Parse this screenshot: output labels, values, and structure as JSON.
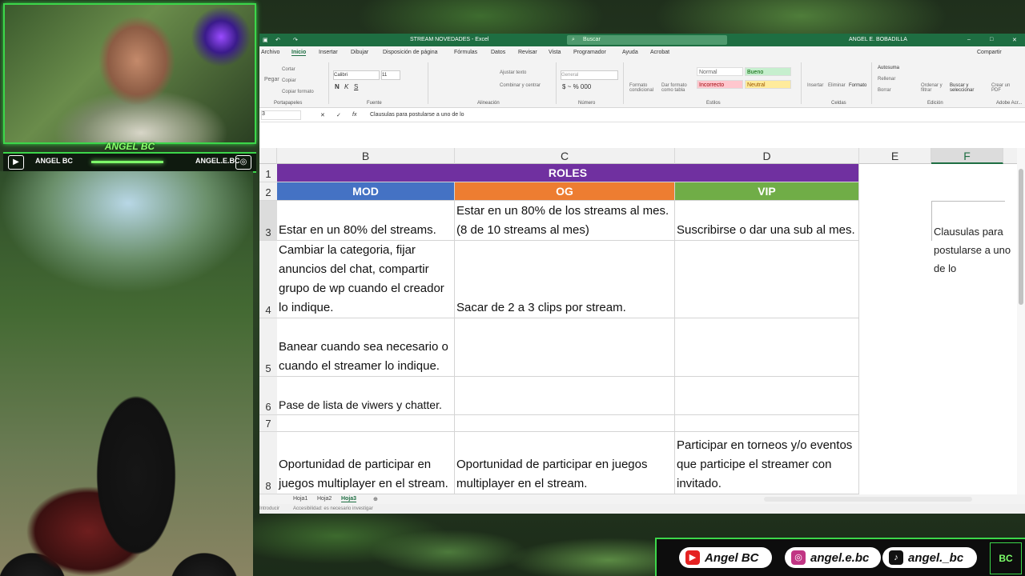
{
  "streamer": {
    "cam_name": "ANGEL BC",
    "cam_left_label": "ANGEL BC",
    "cam_right_label": "ANGEL.E.BC"
  },
  "excel": {
    "title": "STREAM NOVEDADES - Excel",
    "search_placeholder": "Buscar",
    "user": "ANGEL E. BOBADILLA",
    "share_label": "Compartir",
    "menu": [
      "Archivo",
      "Inicio",
      "Insertar",
      "Dibujar",
      "Disposición de página",
      "Fórmulas",
      "Datos",
      "Revisar",
      "Vista",
      "Programador",
      "Ayuda",
      "Acrobat"
    ],
    "ribbon": {
      "font_name": "Calibri",
      "font_size": "11",
      "pegar": "Pegar",
      "cortar": "Cortar",
      "copiar": "Copiar",
      "copiar_formato": "Copiar formato",
      "ajustar_texto": "Ajustar texto",
      "combinar": "Combinar y centrar",
      "number_format": "General",
      "formato_condicional": "Formato condicional",
      "dar_formato_tabla": "Dar formato como tabla",
      "styles": [
        "Normal",
        "Bueno",
        "Incorrecto",
        "Neutral"
      ],
      "insertar": "Insertar",
      "eliminar": "Eliminar",
      "formato": "Formato",
      "autosuma": "Autosuma",
      "rellenar": "Rellenar",
      "borrar": "Borrar",
      "ordenar": "Ordenar y filtrar",
      "buscar": "Buscar y seleccionar",
      "crear_pdf": "Crear un PDF",
      "groups": [
        "Portapapeles",
        "Fuente",
        "Alineación",
        "Número",
        "Estilos",
        "Celdas",
        "Edición",
        "Adobe Acr..."
      ]
    },
    "formula_bar": {
      "name_box": "3",
      "content": "Clausulas para postularse a uno de lo"
    },
    "columns": [
      "B",
      "C",
      "D",
      "E",
      "F"
    ],
    "rows": [
      "1",
      "2",
      "3",
      "4",
      "5",
      "6",
      "7",
      "8"
    ],
    "cells": {
      "roles": "ROLES",
      "mod": "MOD",
      "og": "OG",
      "vip": "VIP",
      "r3b": "Estar en un 80% del streams.",
      "r3c": "Estar en un 80% de los streams al mes. (8 de 10 streams al mes)",
      "r3d": "Suscribirse o dar una sub al mes.",
      "r4b": "Cambiar la categoria, fijar anuncios del chat, compartir grupo de wp cuando el creador lo indique.",
      "r4c": "Sacar de 2 a 3 clips por stream.",
      "r5b": "Banear cuando sea necesario o cuando el streamer lo indique.",
      "r6b": "Pase de lista de viwers y chatter.",
      "r8b": "Oportunidad de participar en juegos multiplayer en el stream.",
      "r8c": "Oportunidad de participar en juegos multiplayer en el stream.",
      "r8d": "Participar en torneos y/o eventos que participe el streamer con invitado.",
      "f_note": "Clausulas para postularse a uno de lo"
    },
    "sheets": [
      "Hoja1",
      "Hoja2",
      "Hoja3"
    ],
    "status": {
      "mode": "Introducir",
      "accessibility": "Accesibilidad: es necesario investigar"
    },
    "colors": {
      "roles": "#7030a0",
      "mod": "#4472c4",
      "og": "#ed7d31",
      "vip": "#70ad47",
      "excel_green": "#1e6e42"
    }
  },
  "social": {
    "youtube": "Angel BC",
    "instagram": "angel.e.bc",
    "tiktok": "angel._bc",
    "logo": "BC"
  }
}
